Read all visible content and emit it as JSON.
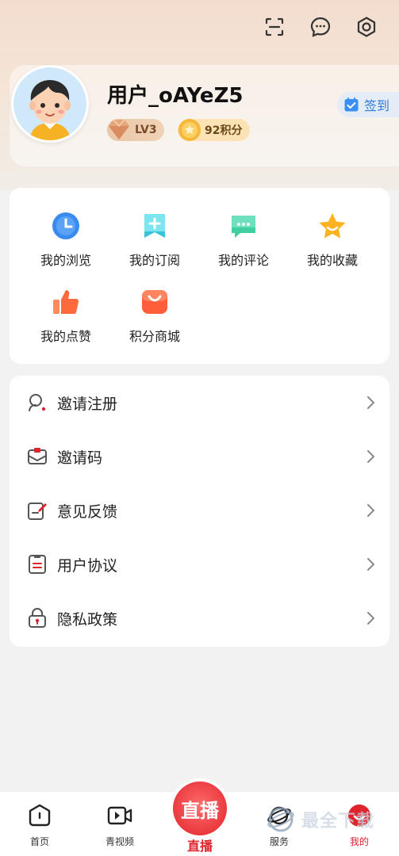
{
  "header": {
    "username": "用户_oAYeZ5",
    "level": "LV3",
    "points": "92积分",
    "signin_label": "签到",
    "icons": [
      "scan-icon",
      "message-icon",
      "settings-icon"
    ]
  },
  "quick_grid": [
    {
      "label": "我的浏览",
      "icon": "history-clock-icon",
      "color": "#3a8bf0"
    },
    {
      "label": "我的订阅",
      "icon": "subscribe-icon",
      "color": "#39c3d9"
    },
    {
      "label": "我的评论",
      "icon": "comment-icon",
      "color": "#3fcfa0"
    },
    {
      "label": "我的收藏",
      "icon": "star-icon",
      "color": "#ffb21f"
    },
    {
      "label": "我的点赞",
      "icon": "thumbs-up-icon",
      "color": "#ff6a3d"
    },
    {
      "label": "积分商城",
      "icon": "shopping-bag-icon",
      "color": "#ff5e3a"
    }
  ],
  "menu": [
    {
      "label": "邀请注册",
      "icon": "invite-user-icon"
    },
    {
      "label": "邀请码",
      "icon": "envelope-icon"
    },
    {
      "label": "意见反馈",
      "icon": "feedback-edit-icon"
    },
    {
      "label": "用户协议",
      "icon": "document-icon"
    },
    {
      "label": "隐私政策",
      "icon": "lock-icon"
    }
  ],
  "tabbar": {
    "tabs": [
      {
        "label": "首页",
        "icon": "home-icon"
      },
      {
        "label": "青视频",
        "icon": "video-icon"
      },
      {
        "label": "直播",
        "icon": "live-icon",
        "button_text": "直播"
      },
      {
        "label": "服务",
        "icon": "service-planet-icon"
      },
      {
        "label": "我的",
        "icon": "profile-icon"
      }
    ],
    "active_color": "#e0242c"
  },
  "watermark": {
    "text": "最全下载"
  }
}
